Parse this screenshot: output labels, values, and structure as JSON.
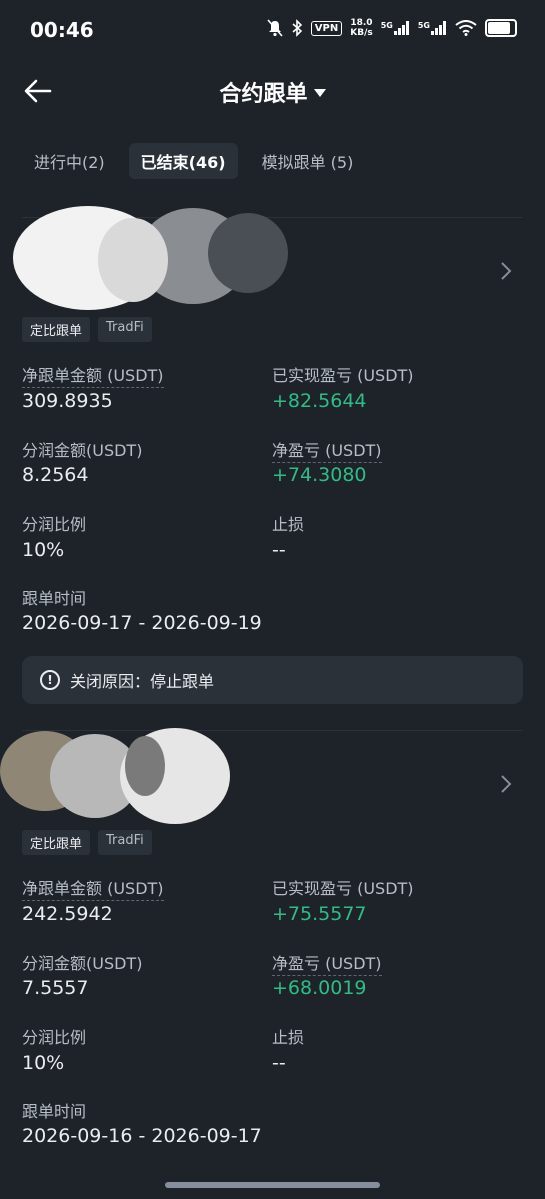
{
  "status_bar": {
    "time": "00:46",
    "vpn_label": "VPN",
    "speed_value": "18.0",
    "speed_unit": "KB/s",
    "network_1": "5G",
    "network_2": "5G",
    "battery_level": 0.8
  },
  "header": {
    "title": "合约跟单"
  },
  "tabs": [
    {
      "label": "进行中(2)",
      "active": false
    },
    {
      "label": "已结束(46)",
      "active": true
    },
    {
      "label": "模拟跟单 (5)",
      "active": false
    }
  ],
  "colors": {
    "background": "#1e2329",
    "positive": "#2ebd85",
    "secondary_text": "#b7bdc6"
  },
  "cards": [
    {
      "tags": [
        "定比跟单",
        "TradFi"
      ],
      "fields": {
        "net_amount_label": "净跟单金额 (USDT)",
        "net_amount_value": "309.8935",
        "realized_pnl_label": "已实现盈亏 (USDT)",
        "realized_pnl_value": "+82.5644",
        "profit_share_amount_label": "分润金额(USDT)",
        "profit_share_amount_value": "8.2564",
        "net_pnl_label": "净盈亏 (USDT)",
        "net_pnl_value": "+74.3080",
        "profit_share_ratio_label": "分润比例",
        "profit_share_ratio_value": "10%",
        "stop_loss_label": "止损",
        "stop_loss_value": "--",
        "period_label": "跟单时间",
        "period_value": "2026-09-17 - 2026-09-19"
      },
      "close_reason": "关闭原因：停止跟单"
    },
    {
      "tags": [
        "定比跟单",
        "TradFi"
      ],
      "fields": {
        "net_amount_label": "净跟单金额 (USDT)",
        "net_amount_value": "242.5942",
        "realized_pnl_label": "已实现盈亏 (USDT)",
        "realized_pnl_value": "+75.5577",
        "profit_share_amount_label": "分润金额(USDT)",
        "profit_share_amount_value": "7.5557",
        "net_pnl_label": "净盈亏 (USDT)",
        "net_pnl_value": "+68.0019",
        "profit_share_ratio_label": "分润比例",
        "profit_share_ratio_value": "10%",
        "stop_loss_label": "止损",
        "stop_loss_value": "--",
        "period_label": "跟单时间",
        "period_value": "2026-09-16 - 2026-09-17"
      }
    }
  ]
}
